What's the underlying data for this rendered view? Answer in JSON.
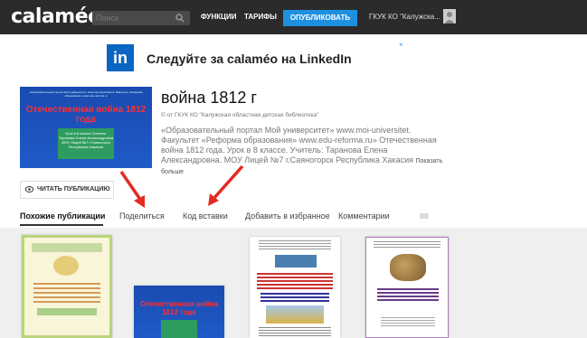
{
  "header": {
    "logo": "calaméo",
    "search_placeholder": "Поиск",
    "nav": [
      "ФУНКЦИИ",
      "ТАРИФЫ"
    ],
    "publish_label": "ОПУБЛИКОВАТЬ",
    "user_name": "ГКУК КО \"Калужска..."
  },
  "ad": {
    "brand": "in",
    "text": "Следуйте за calaméo на LinkedIn",
    "close": "×"
  },
  "document": {
    "cover": {
      "top_text": "«Образовательный портал Мой университет» www.moi-universitet.ru Факультет «Реформа образования» www.edu-reforma.ru",
      "title": "Отечественная война 1812 года",
      "box_text": "Урок в 8 классе Учитель: Таранова Елена Александровна МОУ Лицей №7 г.Саяногорск Республика Хакасия"
    },
    "title": "война 1812 г",
    "publisher": "© от ГКУК КО \"Калужская областная детская библиотека\"",
    "description": "«Образовательный портал Мой университет» www.moi-universitet. Факультет «Реформа образования» www.edu-reforma.ru» Отечественная война 1812 года. Урок в 8 классе. Учитель: Таранова Елена Александровна. МОУ Лицей №7 г.Саяногорск Республика Хакасия",
    "more_label": "Показать больше",
    "read_button": "ЧИТАТЬ ПУБЛИКАЦИЮ"
  },
  "tabs": [
    "Похожие публикации",
    "Поделиться",
    "Код вставки",
    "Добавить в избранное",
    "Комментарии"
  ],
  "gallery": {
    "thumb2_title": "Отечественная война 1812 года"
  },
  "colors": {
    "topbar": "#2b2b2b",
    "publish": "#1e90e0",
    "linkedin": "#0a66c2",
    "arrow": "#e32b22"
  }
}
